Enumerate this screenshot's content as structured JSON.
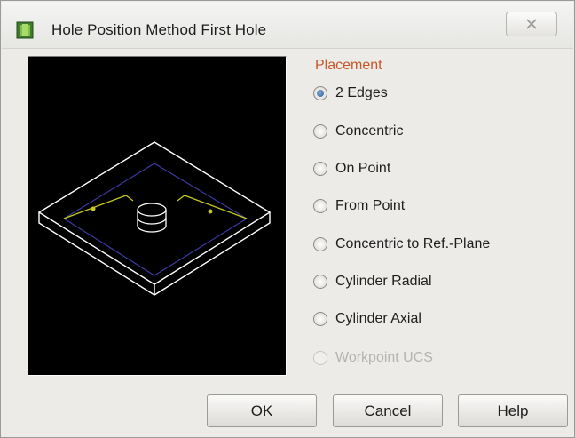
{
  "window": {
    "title": "Hole Position Method First Hole",
    "close_icon": "close-icon"
  },
  "placement": {
    "group_label": "Placement",
    "options": [
      {
        "label": "2 Edges",
        "checked": true,
        "enabled": true
      },
      {
        "label": "Concentric",
        "checked": false,
        "enabled": true
      },
      {
        "label": "On Point",
        "checked": false,
        "enabled": true
      },
      {
        "label": "From Point",
        "checked": false,
        "enabled": true
      },
      {
        "label": "Concentric to Ref.-Plane",
        "checked": false,
        "enabled": true
      },
      {
        "label": "Cylinder Radial",
        "checked": false,
        "enabled": true
      },
      {
        "label": "Cylinder Axial",
        "checked": false,
        "enabled": true
      },
      {
        "label": "Workpoint UCS",
        "checked": false,
        "enabled": false
      }
    ]
  },
  "buttons": {
    "ok": "OK",
    "cancel": "Cancel",
    "help": "Help"
  },
  "colors": {
    "placement_label": "#c6572b",
    "preview_background": "#000000",
    "plate_lines": "#ffffff",
    "edge_lines": "#c8c820",
    "base_outline": "#3a3aa0"
  }
}
